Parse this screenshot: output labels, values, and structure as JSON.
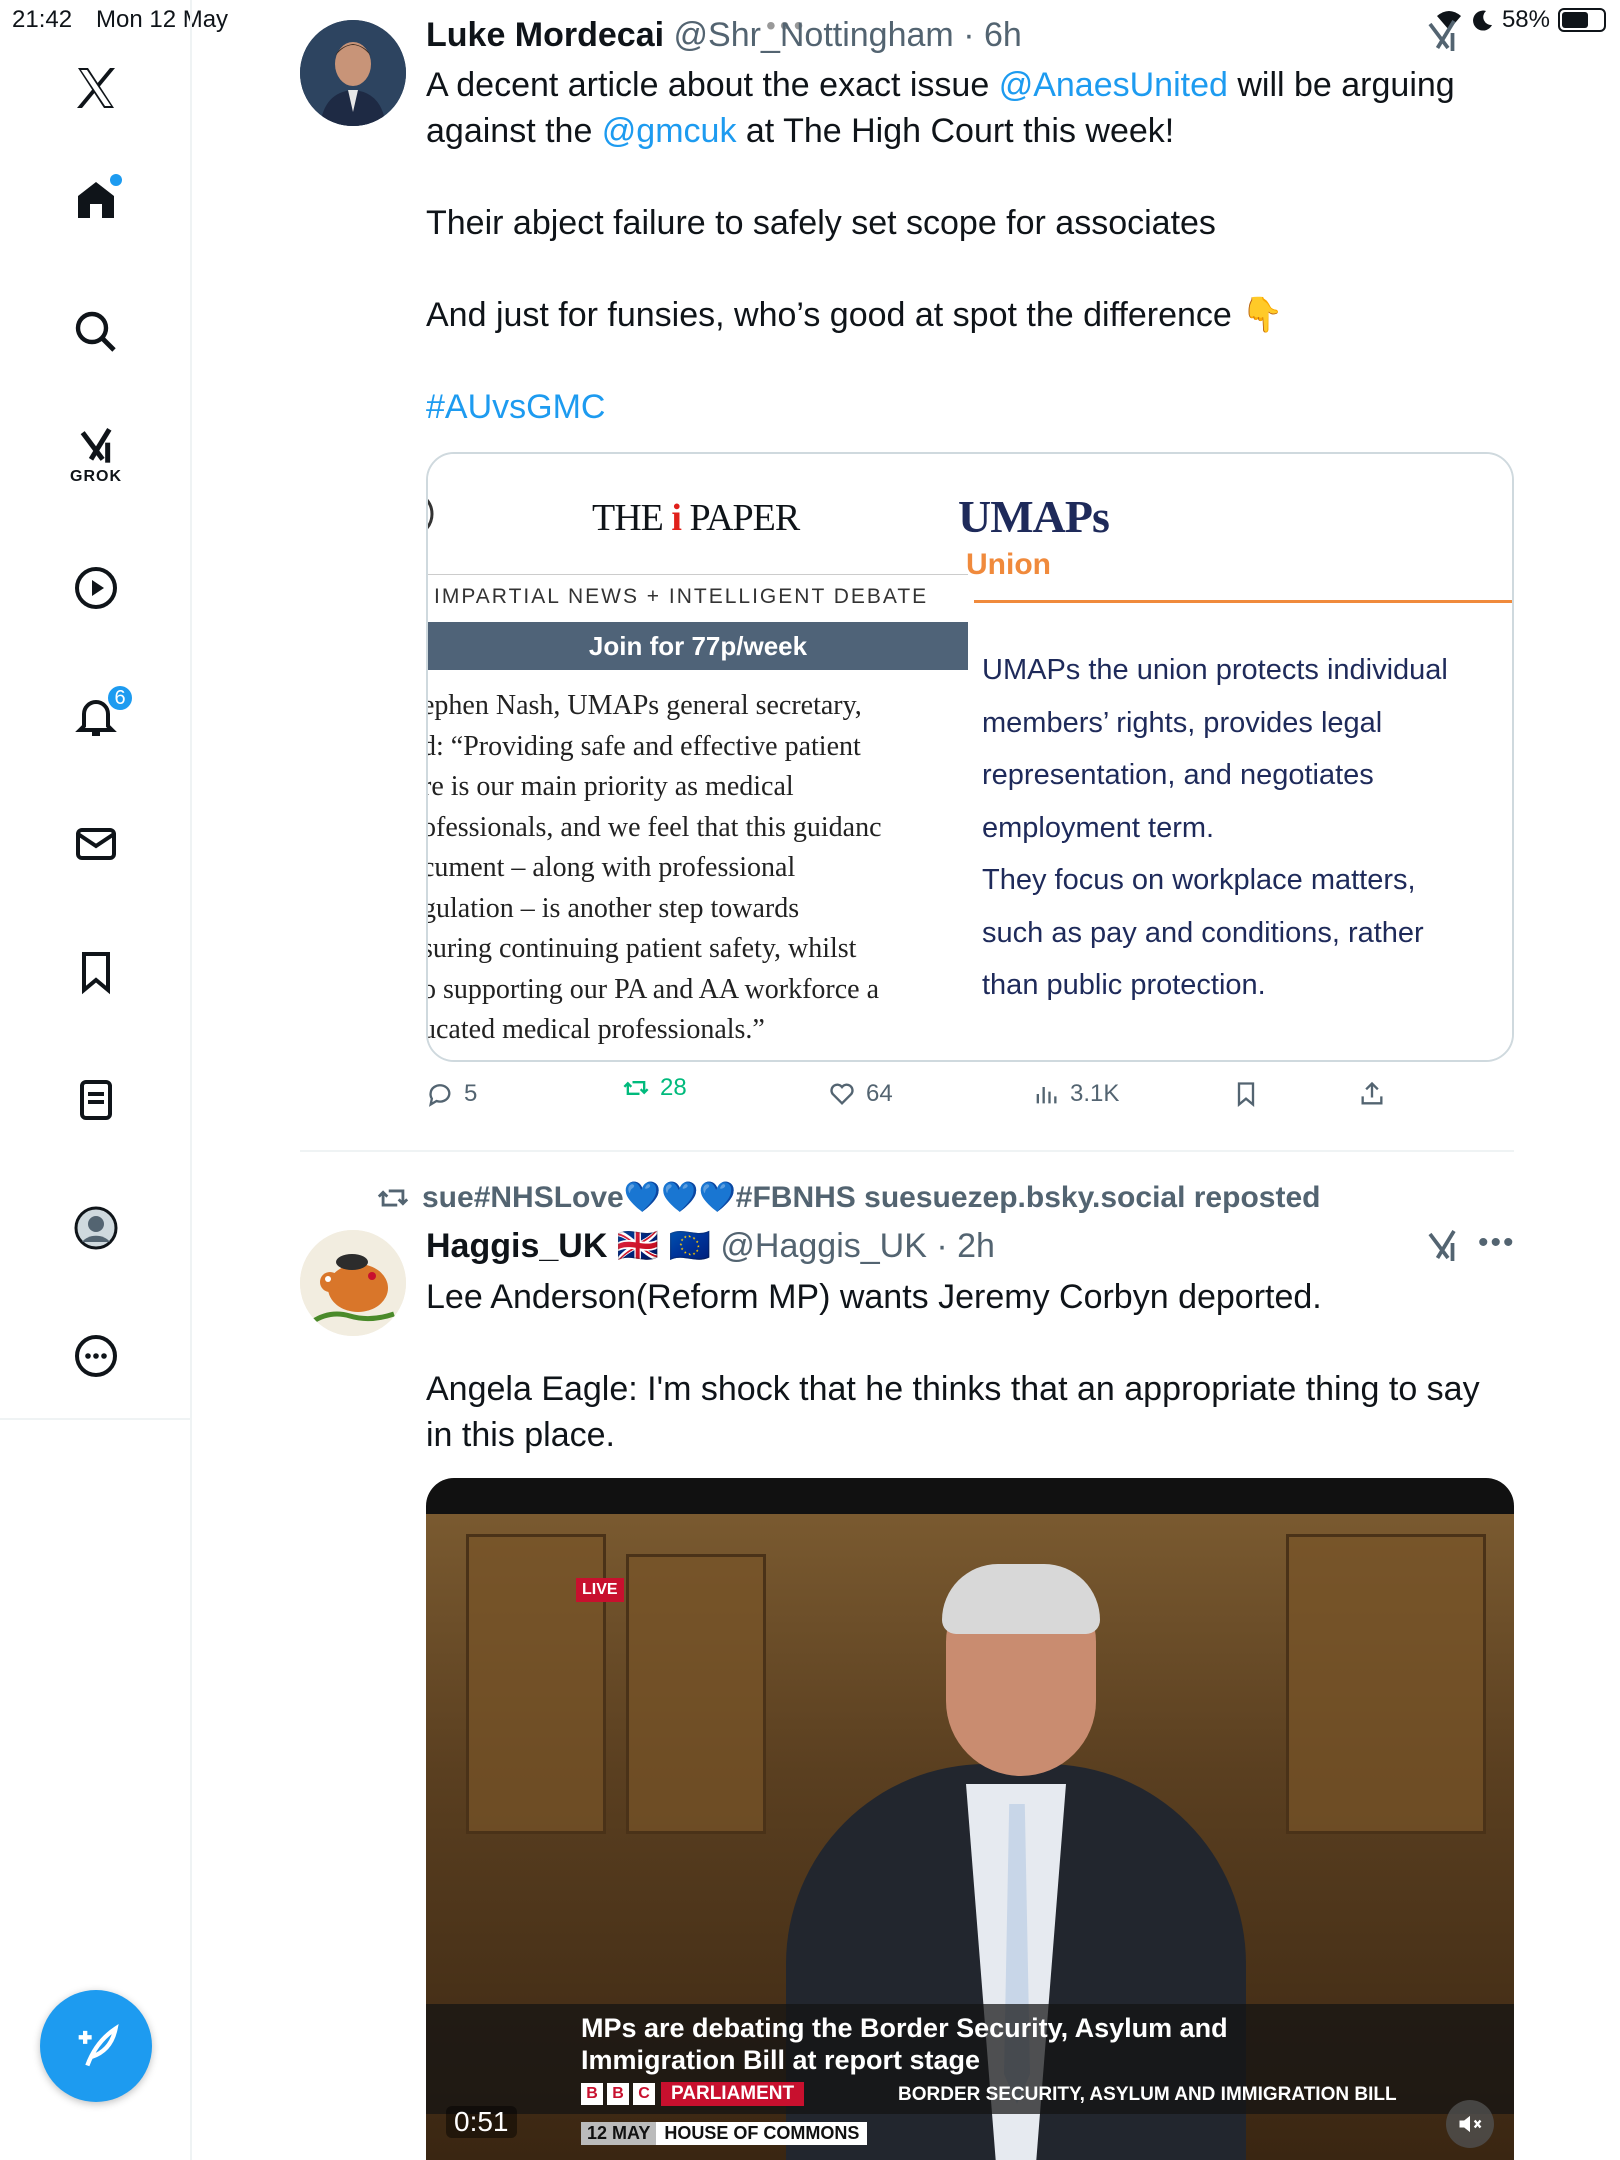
{
  "status_bar": {
    "time": "21:42",
    "date": "Mon 12 May",
    "battery": "58%",
    "battery_level": 0.58
  },
  "sidebar": {
    "notifications_count": "6",
    "grok_label": "GROK",
    "items": [
      "home-icon",
      "search-icon",
      "grok-icon",
      "video-icon",
      "bell-icon",
      "mail-icon",
      "bookmark-icon",
      "lists-icon",
      "profile-icon",
      "more-icon"
    ]
  },
  "tweet1": {
    "name": "Luke Mordecai",
    "handle": "@Shr_Nottingham",
    "time": "· 6h",
    "text_line1_a": "A decent article about the exact issue ",
    "mention1": "@AnaesUnited",
    "text_line1_b": " will be arguing",
    "text_line2_a": "against the ",
    "mention2": "@gmcuk",
    "text_line2_b": " at The High Court this week!",
    "para2": "Their abject failure to safely set scope for associates",
    "para3": "And just for funsies, who’s good at spot the difference 👇",
    "hashtag": "#AUvsGMC",
    "card": {
      "left": {
        "logo_the": "THE",
        "logo_i": "i",
        "logo_paper": "PAPER",
        "tagline": "IMPARTIAL NEWS + INTELLIGENT DEBATE",
        "join": "Join for 77p/week",
        "body_lines": [
          "ephen Nash, UMAPs general secretary,",
          "d: “Providing safe and effective patient",
          "re is our main priority as medical",
          "ofessionals, and we feel that this guidanc",
          "cument – along with professional",
          "gulation – is another step towards",
          "suring continuing patient safety, whilst",
          "o supporting our PA and AA workforce a",
          "ucated medical professionals.”"
        ]
      },
      "right": {
        "logo": "UMAPs",
        "union": "Union",
        "body_lines": [
          "UMAPs the union protects individual",
          "members’ rights, provides legal",
          "representation, and negotiates",
          "employment term.",
          "They focus on workplace matters,",
          "such as pay and conditions, rather",
          "than public protection."
        ]
      }
    },
    "actions": {
      "replies": "5",
      "reposts": "28",
      "likes": "64",
      "views": "3.1K"
    }
  },
  "tweet2": {
    "repost_by": "sue#NHSLove💙💙💙#FBNHS suesuezep.bsky.social reposted",
    "name": "Haggis_UK",
    "flags": "🇬🇧 🇪🇺",
    "handle": "@Haggis_UK",
    "time": "· 2h",
    "para1": "Lee Anderson(Reform MP) wants Jeremy Corbyn deported.",
    "para2_line1": "Angela Eagle: I'm shock that he thinks that an appropriate thing to say",
    "para2_line2": "in this place.",
    "video": {
      "live": "LIVE",
      "caption_line1": "MPs are debating the Border Security, Asylum and",
      "caption_line2": "Immigration Bill at report stage",
      "bbc": [
        "B",
        "B",
        "C"
      ],
      "channel": "PARLIAMENT",
      "bill": "BORDER SECURITY, ASYLUM AND IMMIGRATION BILL",
      "date": "12 MAY",
      "house": "HOUSE OF COMMONS",
      "time": "0:51"
    }
  },
  "colors": {
    "accent": "#1d9bf0",
    "repost_green": "#00ba7c",
    "muted": "#536471"
  }
}
